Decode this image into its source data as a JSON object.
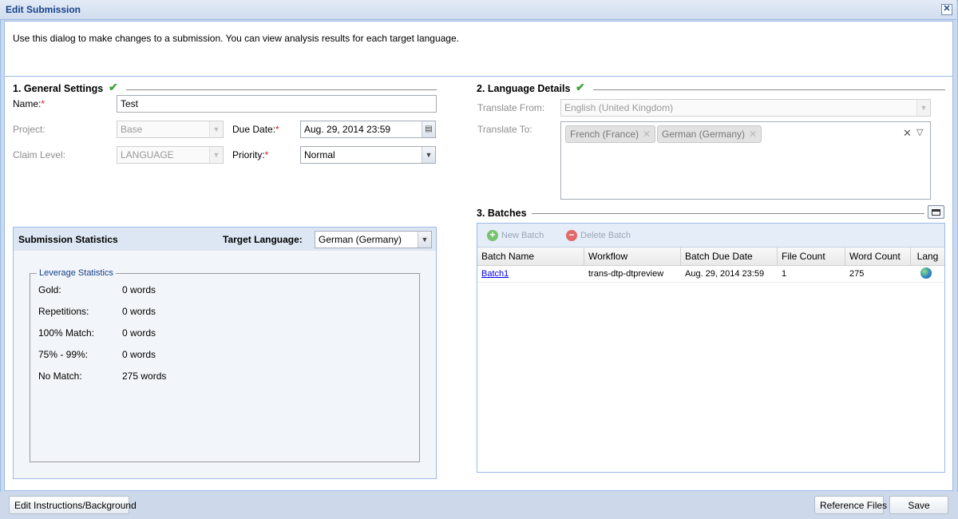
{
  "window": {
    "title": "Edit Submission"
  },
  "intro": "Use this dialog to make changes to a submission. You can view analysis results for each target language.",
  "general": {
    "title": "1. General Settings",
    "name_label": "Name:",
    "name_value": "Test",
    "project_label": "Project:",
    "project_value": "Base",
    "due_date_label": "Due Date:",
    "due_date_value": "Aug. 29, 2014 23:59",
    "claim_label": "Claim Level:",
    "claim_value": "LANGUAGE",
    "priority_label": "Priority:",
    "priority_value": "Normal",
    "required_mark": "*"
  },
  "stats": {
    "title": "Submission Statistics",
    "target_label": "Target Language:",
    "target_value": "German (Germany)",
    "legend": "Leverage Statistics",
    "rows": [
      {
        "label": "Gold:",
        "value": "0 words"
      },
      {
        "label": "Repetitions:",
        "value": "0 words"
      },
      {
        "label": "100% Match:",
        "value": "0 words"
      },
      {
        "label": "75% - 99%:",
        "value": "0 words"
      },
      {
        "label": "No Match:",
        "value": "275 words"
      }
    ]
  },
  "language": {
    "title": "2. Language Details",
    "from_label": "Translate From:",
    "from_value": "English (United Kingdom)",
    "to_label": "Translate To:",
    "to_tags": [
      "French (France)",
      "German (Germany)"
    ]
  },
  "batches": {
    "title": "3. Batches",
    "new_label": "New Batch",
    "delete_label": "Delete Batch",
    "columns": [
      "Batch Name",
      "Workflow",
      "Batch Due Date",
      "File Count",
      "Word Count",
      "Lang"
    ],
    "rows": [
      {
        "name": "Batch1",
        "workflow": "trans-dtp-dtpreview",
        "due": "Aug. 29, 2014 23:59",
        "files": "1",
        "words": "275",
        "lang_icon": "globe-icon"
      }
    ]
  },
  "footer": {
    "edit_instructions": "Edit Instructions/Background",
    "reference_files": "Reference Files",
    "save": "Save"
  },
  "colors": {
    "title": "#15428b",
    "accent_border": "#99bbe8",
    "required": "#d62020",
    "check": "#3aa335",
    "link": "#0000ee"
  }
}
